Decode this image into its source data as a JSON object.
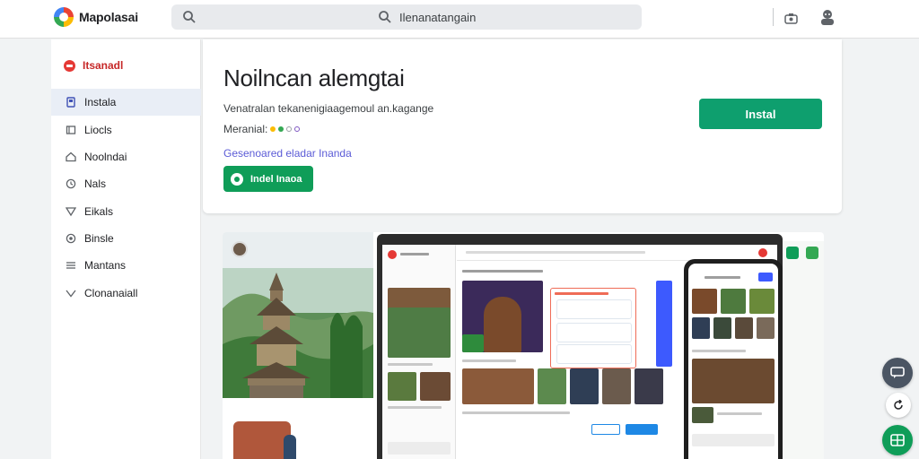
{
  "header": {
    "logo_text": "Mapolasai",
    "search_value": "Ilenanatangain",
    "search_placeholder": "Search"
  },
  "sidebar": {
    "section_label": "Itsanadl",
    "items": [
      {
        "label": "Instala",
        "icon": "app-icon"
      },
      {
        "label": "Liocls",
        "icon": "book-icon"
      },
      {
        "label": "Noolndai",
        "icon": "home-icon"
      },
      {
        "label": "Nals",
        "icon": "clock-icon"
      },
      {
        "label": "Eikals",
        "icon": "tag-icon"
      },
      {
        "label": "Binsle",
        "icon": "circle-icon"
      },
      {
        "label": "Mantans",
        "icon": "list-icon"
      },
      {
        "label": "Clonanaiall",
        "icon": "shield-icon"
      }
    ]
  },
  "app": {
    "title": "Noilncan alemgtai",
    "description": "Venatralan tekanenigiaagemoul an.kagange",
    "rating_label": "Meranial:",
    "link_text": "Gesenoared eladar Inanda",
    "secondary_button": "Indel Inaoa",
    "install_button": "Instal"
  },
  "colors": {
    "accent": "#0e9f6e",
    "link": "#5b5bd6",
    "brand_red": "#e53935"
  }
}
